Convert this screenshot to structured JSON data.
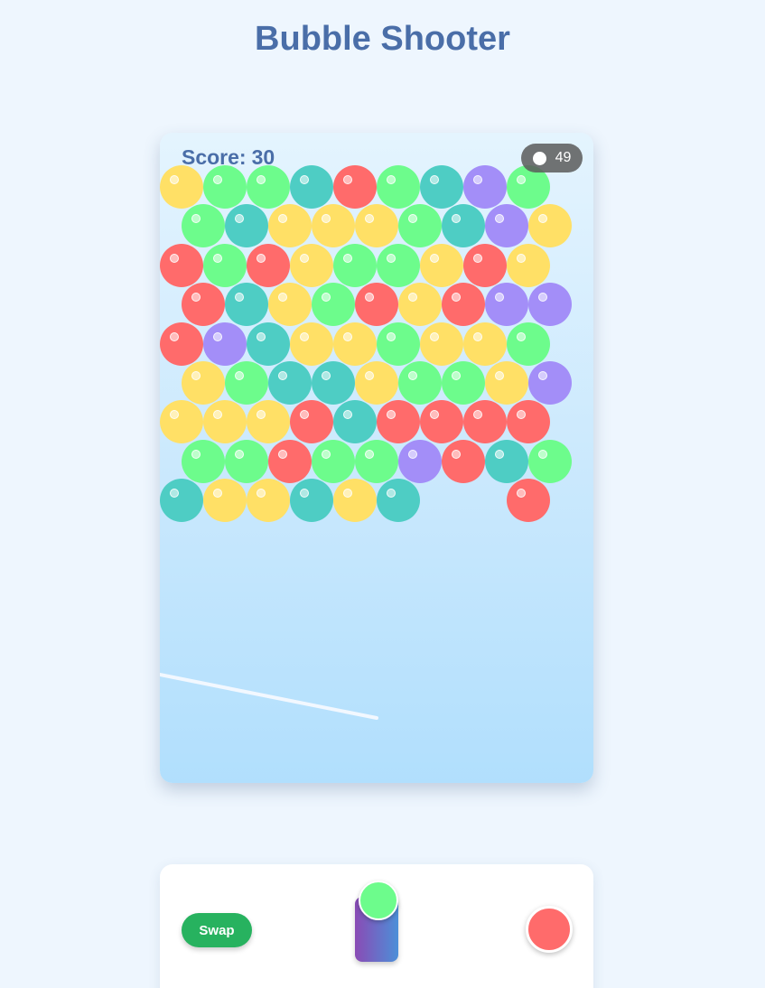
{
  "title": "Bubble Shooter",
  "score": {
    "label": "Score:",
    "value": "30"
  },
  "shots": {
    "remaining": "49"
  },
  "colors": {
    "yellow": "#ffe066",
    "green": "#6dfc8c",
    "teal": "#4ecdc4",
    "red": "#ff6b6b",
    "purple": "#a38ef8"
  },
  "grid": [
    [
      "yellow",
      "green",
      "green",
      "teal",
      "red",
      "green",
      "teal",
      "purple",
      "green"
    ],
    [
      "green",
      "teal",
      "yellow",
      "yellow",
      "yellow",
      "green",
      "teal",
      "purple",
      "yellow"
    ],
    [
      "red",
      "green",
      "red",
      "yellow",
      "green",
      "green",
      "yellow",
      "red",
      "yellow"
    ],
    [
      "red",
      "teal",
      "yellow",
      "green",
      "red",
      "yellow",
      "red",
      "purple",
      "purple"
    ],
    [
      "red",
      "purple",
      "teal",
      "yellow",
      "yellow",
      "green",
      "yellow",
      "yellow",
      "green"
    ],
    [
      "yellow",
      "green",
      "teal",
      "teal",
      "yellow",
      "green",
      "green",
      "yellow",
      "purple"
    ],
    [
      "yellow",
      "yellow",
      "yellow",
      "red",
      "teal",
      "red",
      "red",
      "red",
      "red"
    ],
    [
      "green",
      "green",
      "red",
      "green",
      "green",
      "purple",
      "red",
      "teal",
      "green"
    ],
    [
      "teal",
      "yellow",
      "yellow",
      "teal",
      "yellow",
      "teal",
      null,
      null,
      "red"
    ]
  ],
  "controls": {
    "swap_label": "Swap",
    "current_bubble": "green",
    "next_bubble": "red"
  }
}
